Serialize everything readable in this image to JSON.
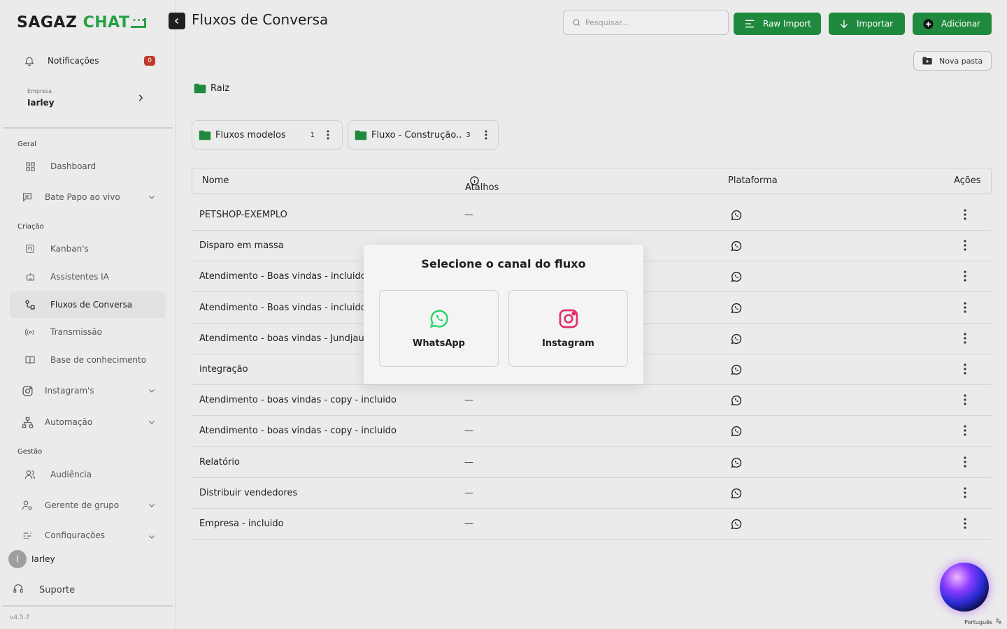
{
  "logo": {
    "part1": "SAGAZ",
    "part2": "CHAT"
  },
  "sidebar": {
    "notifications": {
      "label": "Notificações",
      "count": "0"
    },
    "company": {
      "small_label": "Empresa",
      "name": "Iarley"
    },
    "sections": {
      "geral": "Geral",
      "criacao": "Criação",
      "gestao": "Gestão"
    },
    "items": {
      "dashboard": "Dashboard",
      "live_chat": "Bate Papo ao vivo",
      "kanban": "Kanban's",
      "assistants": "Assistentes IA",
      "flows": "Fluxos de Conversa",
      "broadcast": "Transmissão",
      "knowledge": "Base de conhecimento",
      "instagram": "Instagram's",
      "automation": "Automação",
      "audience": "Audiência",
      "group_manager": "Gerente de grupo",
      "settings": "Configurações"
    },
    "user": {
      "initial": "I",
      "name": "Iarley"
    },
    "support": "Suporte",
    "version": "v4.5.7"
  },
  "header": {
    "title": "Fluxos de Conversa",
    "search_placeholder": "Pesquisar...",
    "raw_import": "Raw Import",
    "import": "Importar",
    "add": "Adicionar",
    "new_folder": "Nova pasta"
  },
  "breadcrumb": {
    "root": "Raiz"
  },
  "folders": [
    {
      "name": "Fluxos modelos",
      "count": "1"
    },
    {
      "name": "Fluxo - Construção..",
      "count": "3"
    }
  ],
  "table": {
    "headers": {
      "name": "Nome",
      "shortcuts": "Atalhos",
      "platform": "Plataforma",
      "actions": "Ações"
    },
    "dash": "—",
    "rows": [
      "PETSHOP-EXEMPLO",
      "Disparo em massa",
      "Atendimento - Boas vindas - incluido",
      "Atendimento - Boas vindas - incluido",
      "Atendimento - boas vindas - Jundjau",
      "integração",
      "Atendimento - boas vindas - copy - incluido",
      "Atendimento - boas vindas - copy - incluido",
      "Relatório",
      "Distribuir vendedores",
      "Empresa - incluido"
    ]
  },
  "modal": {
    "title": "Selecione o canal do fluxo",
    "whatsapp": "WhatsApp",
    "instagram": "Instagram"
  },
  "footer": {
    "language": "Português"
  },
  "colors": {
    "accent": "#1f8a3d",
    "whatsapp": "#25d366",
    "instagram": "#e1306c",
    "badge": "#c0392b"
  }
}
